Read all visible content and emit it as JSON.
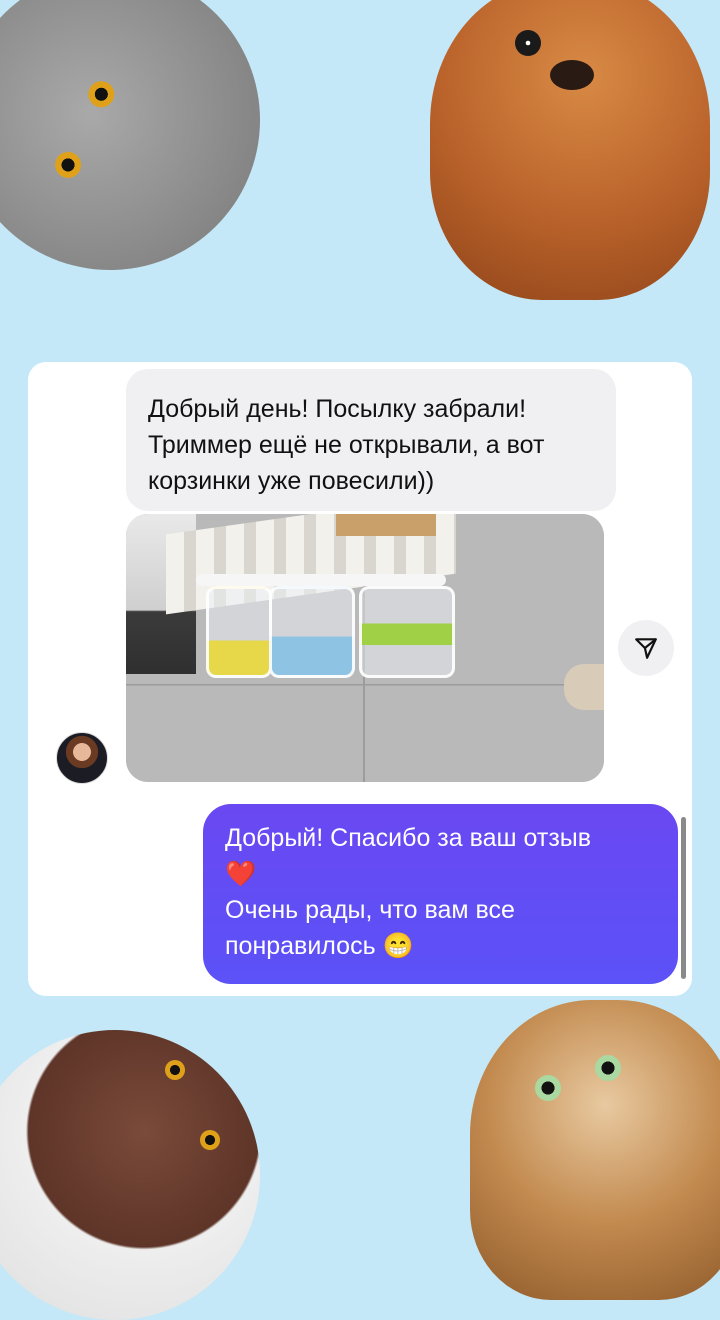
{
  "chat": {
    "incoming": {
      "text": "Добрый день! Посылку забрали! Триммер ещё не открывали, а вот корзинки уже повесили))"
    },
    "outgoing": {
      "line1": "Добрый! Спасибо за ваш отзыв",
      "line2": "❤️",
      "line3": "Очень рады, что вам все",
      "line4": "понравилось 😁"
    }
  },
  "icons": {
    "share": "share-send-icon",
    "avatar": "contact-avatar"
  },
  "colors": {
    "background": "#c4e8f7",
    "card": "#ffffff",
    "incoming_bubble": "#f0f0f2",
    "outgoing_bubble": "#5b4ff5"
  }
}
